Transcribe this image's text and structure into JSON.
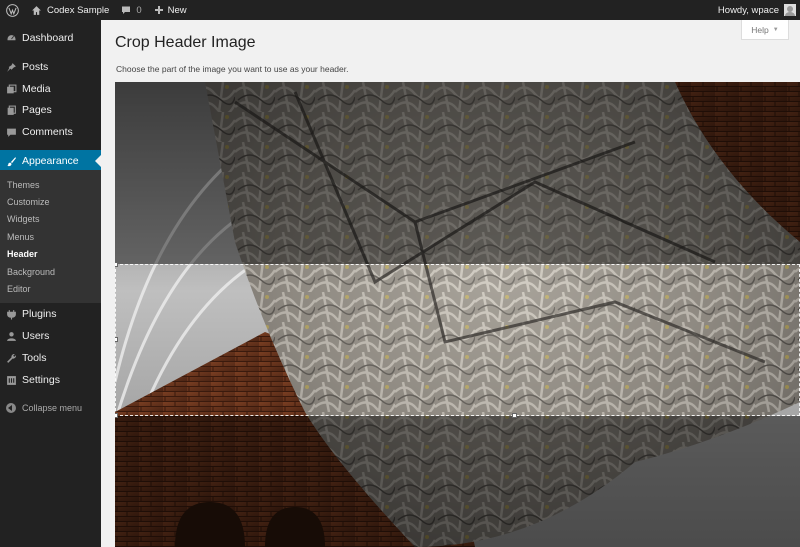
{
  "adminbar": {
    "logo_icon": "wordpress-icon",
    "site_icon": "home-icon",
    "site_name": "Codex Sample",
    "comments_icon": "comment-bubble-icon",
    "comments_count": "0",
    "new_icon": "plus-icon",
    "new_label": "New",
    "howdy": "Howdy, wpace",
    "avatar_icon": "user-avatar-icon"
  },
  "sidebar": {
    "items": [
      {
        "label": "Dashboard",
        "icon": "dashboard-icon"
      },
      {
        "label": "Posts",
        "icon": "pin-icon"
      },
      {
        "label": "Media",
        "icon": "media-icon"
      },
      {
        "label": "Pages",
        "icon": "pages-icon"
      },
      {
        "label": "Comments",
        "icon": "comment-icon"
      },
      {
        "label": "Appearance",
        "icon": "paintbrush-icon"
      },
      {
        "label": "Plugins",
        "icon": "plugin-icon"
      },
      {
        "label": "Users",
        "icon": "users-icon"
      },
      {
        "label": "Tools",
        "icon": "wrench-icon"
      },
      {
        "label": "Settings",
        "icon": "settings-icon"
      }
    ],
    "submenu": [
      "Themes",
      "Customize",
      "Widgets",
      "Menus",
      "Header",
      "Background",
      "Editor"
    ],
    "collapse_label": "Collapse menu"
  },
  "main": {
    "title": "Crop Header Image",
    "description": "Choose the part of the image you want to use as your header.",
    "help_label": "Help",
    "help_arrow": "▼"
  },
  "colors": {
    "adminbar_bg": "#222222",
    "sidebar_bg": "#222222",
    "submenu_bg": "#333333",
    "accent": "#0074a2",
    "content_bg": "#f1f1f1"
  }
}
